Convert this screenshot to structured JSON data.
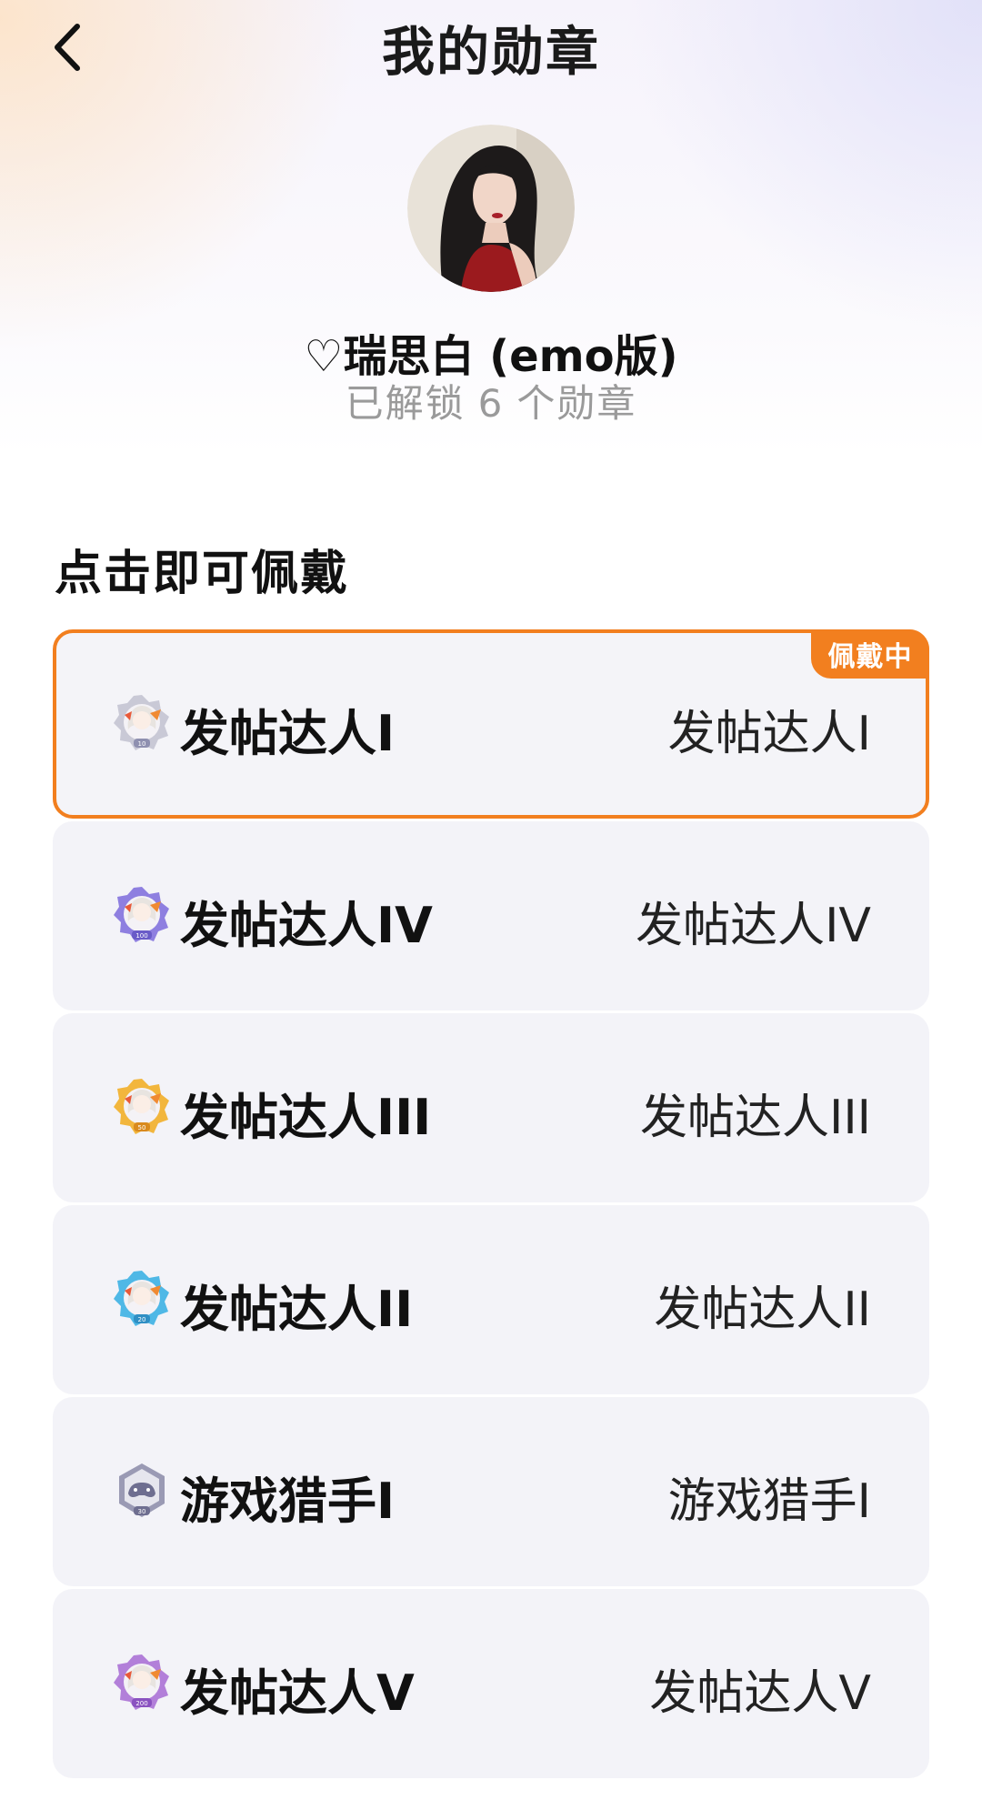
{
  "header": {
    "title": "我的勋章",
    "back_icon": "chevron-left-icon"
  },
  "profile": {
    "username": "♡瑞思白 (emo版)",
    "unlock_prefix": "已解锁",
    "unlock_count": "6",
    "unlock_suffix": "个勋章"
  },
  "section": {
    "title": "点击即可佩戴"
  },
  "badges": [
    {
      "name": "发帖达人I",
      "description": "发帖达人I",
      "level": "10",
      "color": "#c9c9d6",
      "active": true,
      "tag": "佩戴中"
    },
    {
      "name": "发帖达人IV",
      "description": "发帖达人IV",
      "level": "100",
      "color": "#8e7fe0",
      "active": false
    },
    {
      "name": "发帖达人III",
      "description": "发帖达人III",
      "level": "50",
      "color": "#f2b63d",
      "active": false
    },
    {
      "name": "发帖达人II",
      "description": "发帖达人II",
      "level": "20",
      "color": "#4fb8e6",
      "active": false
    },
    {
      "name": "游戏猎手I",
      "description": "游戏猎手I",
      "level": "30",
      "color": "#8a8aa8",
      "active": false
    },
    {
      "name": "发帖达人V",
      "description": "发帖达人V",
      "level": "200",
      "color": "#b27fd9",
      "active": false
    }
  ],
  "colors": {
    "accent": "#f27f1f",
    "card_bg": "#f3f3f8",
    "muted_text": "#9a9a9a"
  }
}
